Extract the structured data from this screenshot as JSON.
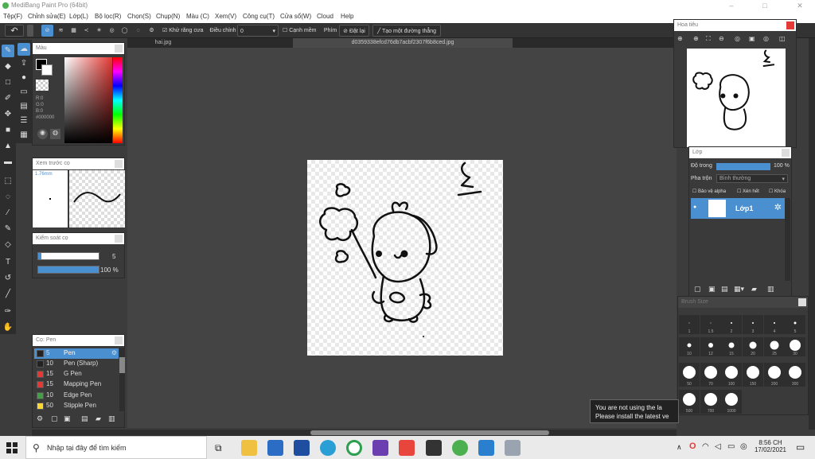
{
  "window": {
    "title": "MediBang Paint Pro (64bit)",
    "controls": [
      "–",
      "□",
      "✕"
    ]
  },
  "menu": [
    "Tệp(F)",
    "Chỉnh sửa(E)",
    "Lớp(L)",
    "Bộ lọc(R)",
    "Chọn(S)",
    "Chụp(N)",
    "Màu (C)",
    "Xem(V)",
    "Công cụ(T)",
    "Cửa sổ(W)",
    "Cloud",
    "Help"
  ],
  "toolbar": {
    "antialias_label": "Khử răng cưa",
    "adjust_label": "Điều chỉnh",
    "adjust_value": "0",
    "sharp_label": "Cạnh mềm",
    "key_label": "Phím",
    "reset_label": "Đặt lại",
    "straight_label": "Tạo một đường thẳng"
  },
  "tabs": [
    "hai.jpg",
    "d0359338efcd76db7acbf2307f6b8ced.jpg"
  ],
  "color_panel": {
    "title": "Màu",
    "rgb": [
      "R:0",
      "G:0",
      "B:0"
    ],
    "hex": "#000000"
  },
  "brush_preview": {
    "title": "Xem trước cọ",
    "size": "1.76mm"
  },
  "brush_control": {
    "title": "Kiểm soát cọ",
    "size_value": "5",
    "opacity_value": "100 %"
  },
  "pen_panel": {
    "title": "Cọ: Pen",
    "items": [
      {
        "size": "5",
        "name": "Pen",
        "color": "#222222"
      },
      {
        "size": "10",
        "name": "Pen (Sharp)",
        "color": "#222222"
      },
      {
        "size": "15",
        "name": "G Pen",
        "color": "#e53935"
      },
      {
        "size": "15",
        "name": "Mapping Pen",
        "color": "#e53935"
      },
      {
        "size": "10",
        "name": "Edge Pen",
        "color": "#43a047"
      },
      {
        "size": "50",
        "name": "Stipple Pen",
        "color": "#fdd835"
      }
    ]
  },
  "navigator": {
    "title": "Hoa tiêu"
  },
  "layer_panel": {
    "title": "Lớp",
    "opacity_label": "Độ trong",
    "opacity_value": "100 %",
    "blend_label": "Pha trộn",
    "blend_value": "Bình thường",
    "protect_alpha": "Bảo vệ alpha",
    "clipping": "Xén hết",
    "lock": "Khóa",
    "layer_name": "Lớp1"
  },
  "brush_size_panel": {
    "title": "Brush Size",
    "rows": [
      [
        "1",
        "1.5",
        "2",
        "3",
        "4",
        "5"
      ],
      [
        "10",
        "12",
        "15",
        "20",
        "25",
        "30"
      ],
      [
        "50",
        "70",
        "100",
        "150",
        "200",
        "300"
      ],
      [
        "500",
        "700",
        "1000"
      ]
    ]
  },
  "notification": {
    "line1": "You are not using the la",
    "line2": "Please install the latest ve"
  },
  "taskbar": {
    "search_placeholder": "Nhập tại đây để tìm kiếm",
    "time": "8:56 CH",
    "date": "17/02/2021",
    "app_colors": [
      "#f0c040",
      "#2b6cc4",
      "#1f4ea0",
      "#e55a2b",
      "#2e9e4f",
      "#6c3fb0",
      "#e8453c",
      "#333333",
      "#4caf50",
      "#2a7fcf",
      "#9aa4b0"
    ]
  }
}
